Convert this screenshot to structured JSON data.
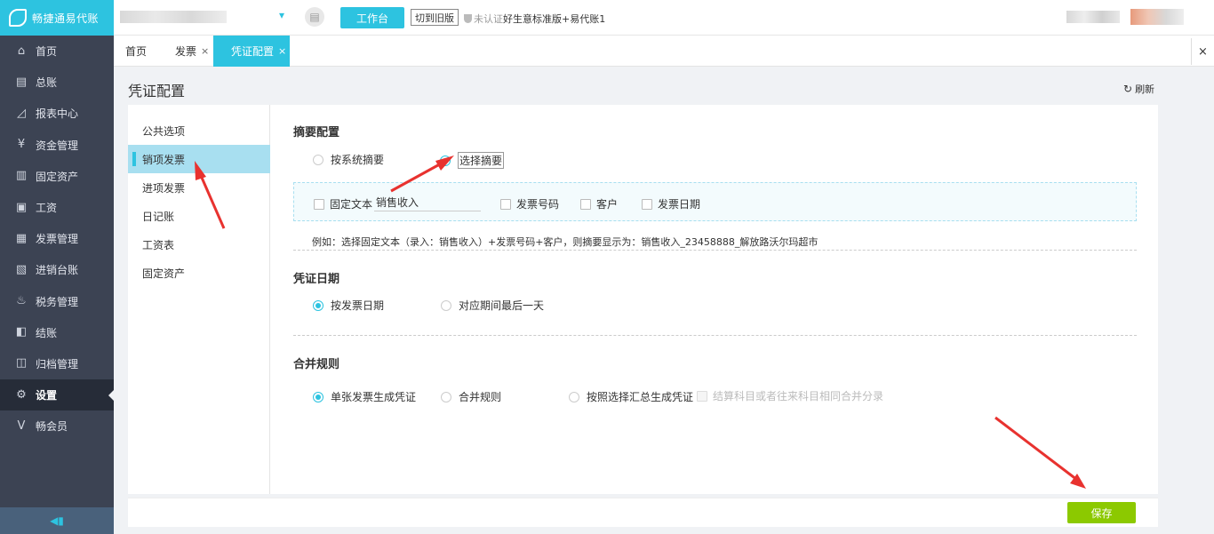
{
  "app": {
    "name": "畅捷通易代账"
  },
  "topbar": {
    "workbench_label": "工作台",
    "old_version_label": "切到旧版",
    "cert_status": "未认证",
    "plan_name": "好生意标准版+易代账1"
  },
  "sidebar": {
    "items": [
      {
        "label": "首页",
        "icon": "home-icon",
        "glyph": "⌂"
      },
      {
        "label": "总账",
        "icon": "ledger-icon",
        "glyph": "▤"
      },
      {
        "label": "报表中心",
        "icon": "chart-icon",
        "glyph": "◿"
      },
      {
        "label": "资金管理",
        "icon": "money-icon",
        "glyph": "¥"
      },
      {
        "label": "固定资产",
        "icon": "asset-icon",
        "glyph": "▥"
      },
      {
        "label": "工资",
        "icon": "salary-icon",
        "glyph": "▣"
      },
      {
        "label": "发票管理",
        "icon": "invoice-icon",
        "glyph": "▦"
      },
      {
        "label": "进销台账",
        "icon": "inventory-icon",
        "glyph": "▧"
      },
      {
        "label": "税务管理",
        "icon": "tax-icon",
        "glyph": "♨"
      },
      {
        "label": "结账",
        "icon": "checkout-icon",
        "glyph": "◧"
      },
      {
        "label": "归档管理",
        "icon": "archive-icon",
        "glyph": "◫"
      },
      {
        "label": "设置",
        "icon": "gear-icon",
        "glyph": "⚙"
      },
      {
        "label": "畅会员",
        "icon": "member-icon",
        "glyph": "V"
      }
    ],
    "active_index": 11,
    "collapse_glyph": "◀▮"
  },
  "tabs": [
    {
      "label": "首页",
      "closable": false
    },
    {
      "label": "发票",
      "closable": true
    },
    {
      "label": "凭证配置",
      "closable": true
    }
  ],
  "tab_close_glyph": "×",
  "page": {
    "title": "凭证配置",
    "refresh_label": "刷新"
  },
  "left_nav": {
    "items": [
      "公共选项",
      "销项发票",
      "进项发票",
      "日记账",
      "工资表",
      "固定资产"
    ],
    "active_index": 1
  },
  "summary_config": {
    "title": "摘要配置",
    "options": [
      "按系统摘要",
      "选择摘要"
    ],
    "selected": 1,
    "fixed_text_label": "固定文本",
    "fixed_text_value": "销售收入",
    "invoice_no_label": "发票号码",
    "customer_label": "客户",
    "invoice_date_label": "发票日期",
    "example": "例如：选择固定文本（录入：销售收入）+发票号码+客户，则摘要显示为：销售收入_23458888_解放路沃尔玛超市"
  },
  "voucher_date": {
    "title": "凭证日期",
    "options": [
      "按发票日期",
      "对应期间最后一天"
    ],
    "selected": 0
  },
  "merge_rules": {
    "title": "合并规则",
    "options": [
      "单张发票生成凭证",
      "合并规则",
      "按照选择汇总生成凭证"
    ],
    "selected": 0,
    "checkbox_label": "结算科目或者往来科目相同合并分录"
  },
  "save_label": "保存",
  "colors": {
    "accent": "#2dc3e0",
    "sidebar": "#3c4353",
    "save": "#8cc900",
    "annotation": "#e8322f"
  }
}
